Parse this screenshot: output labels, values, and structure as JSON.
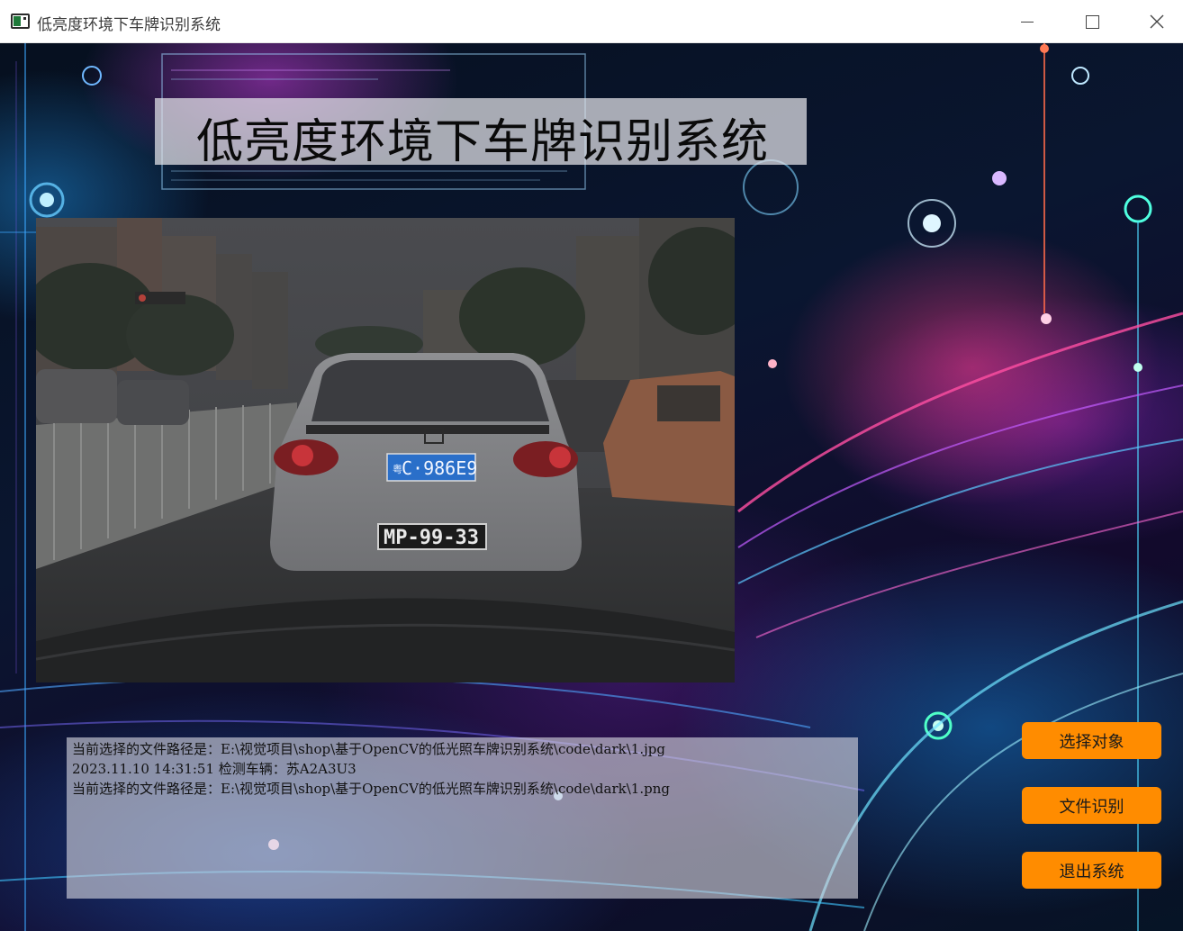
{
  "window": {
    "title": "低亮度环境下车牌识别系统",
    "icon": "app-window-icon",
    "controls": [
      "minimize-icon",
      "maximize-icon",
      "close-icon"
    ]
  },
  "header": {
    "title": "低亮度环境下车牌识别系统"
  },
  "image_view": {
    "front_plate": "C·986E9",
    "front_plate_prefix": "粤",
    "rear_plate": "MP-99-33"
  },
  "log": {
    "lines": [
      "当前选择的文件路径是：E:\\视觉项目\\shop\\基于OpenCV的低光照车牌识别系统\\code\\dark\\1.jpg",
      "2023.11.10 14:31:51 检测车辆：苏A2A3U3",
      "当前选择的文件路径是：E:\\视觉项目\\shop\\基于OpenCV的低光照车牌识别系统\\code\\dark\\1.png"
    ]
  },
  "actions": {
    "select_label": "选择对象",
    "recognize_label": "文件识别",
    "exit_label": "退出系统"
  },
  "colors": {
    "button": "#ff8c00",
    "plate_blue": "#2a6fc9"
  }
}
